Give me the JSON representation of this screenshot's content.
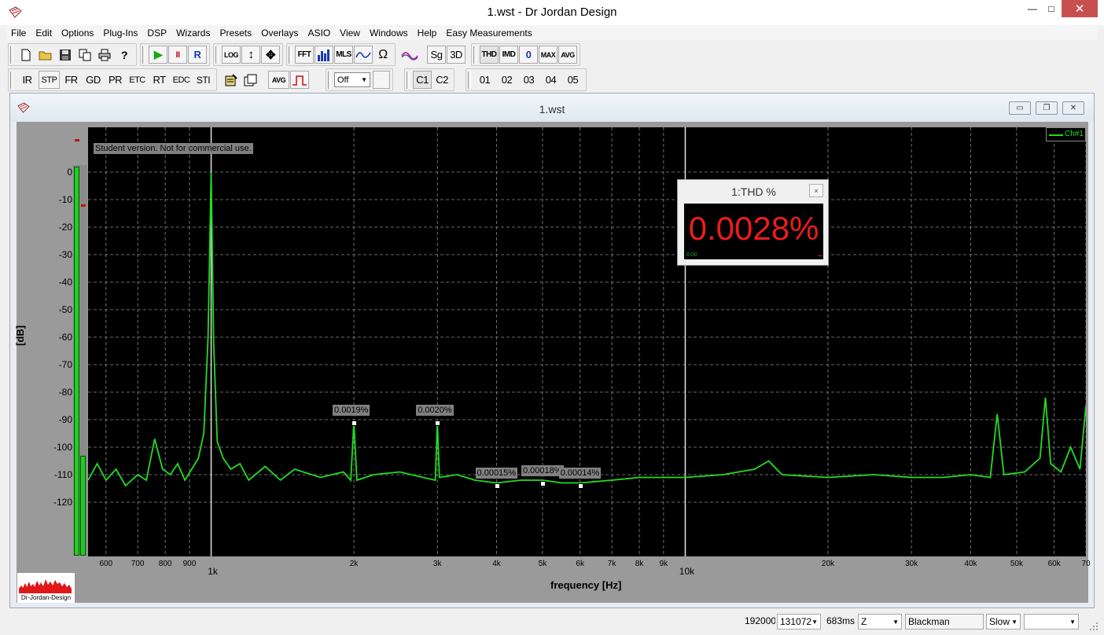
{
  "window": {
    "title": "1.wst - Dr Jordan Design",
    "controls": {
      "minimize": "—",
      "maximize": "□",
      "close": "✕"
    }
  },
  "menu": [
    "File",
    "Edit",
    "Options",
    "Plug-Ins",
    "DSP",
    "Wizards",
    "Presets",
    "Overlays",
    "ASIO",
    "View",
    "Windows",
    "Help",
    "Easy Measurements"
  ],
  "toolbar1": {
    "file_icons": [
      "new-file-icon",
      "open-folder-icon",
      "save-icon",
      "copy-icon",
      "print-icon",
      "help-icon"
    ],
    "transport": {
      "play": "▶",
      "pause": "II",
      "record": "R"
    },
    "view": [
      "LOG",
      "↕",
      "✥"
    ],
    "analysis": [
      "FFT",
      "bars-icon",
      "MLS",
      "sweep-icon",
      "Ω"
    ],
    "misc": [
      "wave-icon",
      "Sg",
      "3D"
    ],
    "measure": [
      "THD",
      "IMD",
      "0",
      "MAX",
      "AVG"
    ]
  },
  "toolbar2": {
    "modes": [
      "IR",
      "STP",
      "FR",
      "GD",
      "PR",
      "ETC",
      "RT",
      "EDC",
      "STI"
    ],
    "tools": [
      "edit-icon",
      "copy-window-icon",
      "AVG",
      "pulse-icon"
    ],
    "select_value": "Off",
    "channels": [
      "C1",
      "C2"
    ],
    "overlays": [
      "01",
      "02",
      "03",
      "04",
      "05"
    ]
  },
  "child_window": {
    "title": "1.wst",
    "controls": {
      "minimize": "▭",
      "restore": "❐",
      "close": "✕"
    }
  },
  "plot": {
    "student_note": "Student version. Not for commercial use.",
    "legend": "Ch#1",
    "ylabel": "[dB]",
    "xlabel": "frequency [Hz]"
  },
  "peak_labels": [
    {
      "text": "0.0019%",
      "freq": 2000,
      "db": -91
    },
    {
      "text": "0.0020%",
      "freq": 3000,
      "db": -91
    },
    {
      "text": "0.00015%",
      "freq": 4000,
      "db": -114
    },
    {
      "text": "0.00018%",
      "freq": 5000,
      "db": -113
    },
    {
      "text": "0.00014%",
      "freq": 6000,
      "db": -114
    }
  ],
  "thd_window": {
    "title": "1:THD %",
    "close": "×",
    "value": "0.0028%",
    "min_label": "0.00"
  },
  "logo": {
    "text": "Dr-Jordan-Design"
  },
  "statusbar": {
    "sample_rate": "192000",
    "fft_size": "131072",
    "duration": "683ms",
    "weighting": "Z",
    "window": "Blackman",
    "speed": "Slow",
    "extra": ""
  },
  "chart_data": {
    "type": "line",
    "title": "",
    "xlabel": "frequency [Hz]",
    "ylabel": "[dB]",
    "x_scale": "log",
    "xlim": [
      550,
      70000
    ],
    "ylim": [
      -140,
      0
    ],
    "x_ticks": [
      {
        "label": "600",
        "value": 600
      },
      {
        "label": "700",
        "value": 700
      },
      {
        "label": "800",
        "value": 800
      },
      {
        "label": "900",
        "value": 900
      },
      {
        "label": "1k",
        "value": 1000,
        "major": true
      },
      {
        "label": "2k",
        "value": 2000
      },
      {
        "label": "3k",
        "value": 3000
      },
      {
        "label": "4k",
        "value": 4000
      },
      {
        "label": "5k",
        "value": 5000
      },
      {
        "label": "6k",
        "value": 6000
      },
      {
        "label": "7k",
        "value": 7000
      },
      {
        "label": "8k",
        "value": 8000
      },
      {
        "label": "9k",
        "value": 9000
      },
      {
        "label": "10k",
        "value": 10000,
        "major": true
      },
      {
        "label": "20k",
        "value": 20000
      },
      {
        "label": "30k",
        "value": 30000
      },
      {
        "label": "40k",
        "value": 40000
      },
      {
        "label": "50k",
        "value": 50000
      },
      {
        "label": "60k",
        "value": 60000
      },
      {
        "label": "70",
        "value": 70000
      }
    ],
    "y_ticks": [
      0,
      -10,
      -20,
      -30,
      -40,
      -50,
      -60,
      -70,
      -80,
      -90,
      -100,
      -110,
      -120
    ],
    "grid": true,
    "legend": "top-right",
    "series": [
      {
        "name": "Ch#1",
        "color": "#22dd22",
        "points": [
          [
            550,
            -112
          ],
          [
            575,
            -106
          ],
          [
            600,
            -112
          ],
          [
            630,
            -108
          ],
          [
            660,
            -114
          ],
          [
            700,
            -110
          ],
          [
            730,
            -112
          ],
          [
            760,
            -97
          ],
          [
            790,
            -108
          ],
          [
            820,
            -110
          ],
          [
            850,
            -106
          ],
          [
            880,
            -112
          ],
          [
            910,
            -108
          ],
          [
            940,
            -104
          ],
          [
            965,
            -95
          ],
          [
            985,
            -60
          ],
          [
            1000,
            0
          ],
          [
            1012,
            -62
          ],
          [
            1030,
            -98
          ],
          [
            1060,
            -104
          ],
          [
            1100,
            -108
          ],
          [
            1150,
            -106
          ],
          [
            1200,
            -112
          ],
          [
            1300,
            -107
          ],
          [
            1400,
            -112
          ],
          [
            1500,
            -108
          ],
          [
            1700,
            -111
          ],
          [
            1900,
            -109
          ],
          [
            1970,
            -112
          ],
          [
            2000,
            -91
          ],
          [
            2030,
            -112
          ],
          [
            2200,
            -110
          ],
          [
            2500,
            -109
          ],
          [
            2800,
            -111
          ],
          [
            2970,
            -112
          ],
          [
            3000,
            -91
          ],
          [
            3030,
            -111
          ],
          [
            3300,
            -110
          ],
          [
            3600,
            -112
          ],
          [
            4000,
            -113
          ],
          [
            4500,
            -112
          ],
          [
            5000,
            -112
          ],
          [
            5500,
            -113
          ],
          [
            6000,
            -113
          ],
          [
            7000,
            -112
          ],
          [
            8000,
            -111
          ],
          [
            9000,
            -111
          ],
          [
            10000,
            -111
          ],
          [
            12000,
            -110
          ],
          [
            14000,
            -108
          ],
          [
            15000,
            -105
          ],
          [
            16000,
            -110
          ],
          [
            20000,
            -111
          ],
          [
            25000,
            -110
          ],
          [
            30000,
            -111
          ],
          [
            35000,
            -111
          ],
          [
            40000,
            -110
          ],
          [
            44000,
            -111
          ],
          [
            45500,
            -88
          ],
          [
            47000,
            -110
          ],
          [
            52000,
            -109
          ],
          [
            56000,
            -104
          ],
          [
            57500,
            -82
          ],
          [
            59000,
            -106
          ],
          [
            62000,
            -109
          ],
          [
            65000,
            -100
          ],
          [
            68000,
            -108
          ],
          [
            70000,
            -85
          ]
        ]
      }
    ]
  }
}
